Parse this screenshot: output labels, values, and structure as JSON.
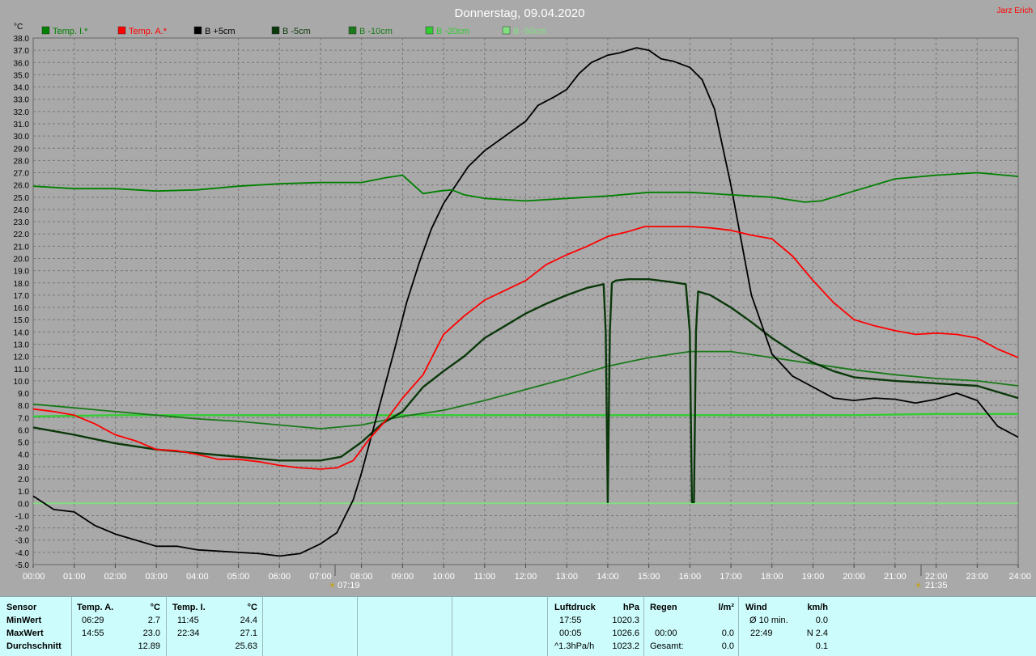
{
  "title": "Donnerstag, 09.04.2020",
  "author": "Jarz Erich",
  "unit_label": "°C",
  "sun_markers": {
    "sunrise": "07:19",
    "sunset": "21:35"
  },
  "chart_data": {
    "type": "line",
    "title": "Donnerstag, 09.04.2020",
    "ylabel": "°C",
    "ylim": [
      -5.0,
      38.0
    ],
    "xlim": [
      0,
      24
    ],
    "grid": true,
    "legend_position": "top",
    "x_ticks": [
      "00:00",
      "01:00",
      "02:00",
      "03:00",
      "04:00",
      "05:00",
      "06:00",
      "07:00",
      "08:00",
      "09:00",
      "10:00",
      "11:00",
      "12:00",
      "13:00",
      "14:00",
      "15:00",
      "16:00",
      "17:00",
      "18:00",
      "19:00",
      "20:00",
      "21:00",
      "22:00",
      "23:00",
      "24:00"
    ],
    "y_ticks": [
      38.0,
      37.0,
      36.0,
      35.0,
      34.0,
      33.0,
      32.0,
      31.0,
      30.0,
      29.0,
      28.0,
      27.0,
      26.0,
      25.0,
      24.0,
      23.0,
      22.0,
      21.0,
      20.0,
      19.0,
      18.0,
      17.0,
      16.0,
      15.0,
      14.0,
      13.0,
      12.0,
      11.0,
      10.0,
      9.0,
      8.0,
      7.0,
      6.0,
      5.0,
      4.0,
      3.0,
      2.0,
      1.0,
      0.0,
      -1.0,
      -2.0,
      -3.0,
      -4.0,
      -5.0
    ],
    "series": [
      {
        "name": "Temp. I.*",
        "color": "#008000",
        "x": [
          0,
          1,
          2,
          3,
          4,
          5,
          6,
          7,
          8,
          8.6,
          9.0,
          9.5,
          9.9,
          10.2,
          10.5,
          11,
          12,
          13,
          14,
          15,
          16,
          17,
          18,
          18.8,
          19.2,
          20,
          21,
          22,
          23,
          24
        ],
        "y": [
          25.9,
          25.7,
          25.7,
          25.5,
          25.6,
          25.9,
          26.1,
          26.2,
          26.2,
          26.6,
          26.8,
          25.3,
          25.5,
          25.6,
          25.2,
          24.9,
          24.7,
          24.9,
          25.1,
          25.4,
          25.4,
          25.2,
          25.0,
          24.6,
          24.7,
          25.5,
          26.5,
          26.8,
          27.0,
          26.7
        ]
      },
      {
        "name": "Temp. A.*",
        "color": "#ff0000",
        "x": [
          0,
          0.5,
          1,
          1.5,
          2,
          2.5,
          3,
          3.5,
          4,
          4.5,
          5,
          5.5,
          6,
          6.5,
          7,
          7.4,
          7.8,
          8.2,
          8.6,
          9.0,
          9.5,
          10,
          10.5,
          11,
          11.5,
          12,
          12.5,
          13,
          13.5,
          14,
          14.5,
          14.9,
          15.5,
          16,
          16.5,
          17,
          17.5,
          18,
          18.5,
          19,
          19.5,
          20,
          20.5,
          21,
          21.5,
          22,
          22.5,
          23,
          23.5,
          24
        ],
        "y": [
          7.7,
          7.5,
          7.2,
          6.5,
          5.6,
          5.1,
          4.4,
          4.3,
          4.0,
          3.6,
          3.6,
          3.4,
          3.1,
          2.9,
          2.8,
          2.9,
          3.5,
          5.3,
          6.8,
          8.6,
          10.5,
          13.8,
          15.3,
          16.6,
          17.4,
          18.2,
          19.5,
          20.3,
          21.0,
          21.8,
          22.2,
          22.6,
          22.6,
          22.6,
          22.5,
          22.3,
          21.9,
          21.6,
          20.2,
          18.2,
          16.4,
          15.0,
          14.5,
          14.1,
          13.8,
          13.9,
          13.8,
          13.5,
          12.6,
          11.9
        ]
      },
      {
        "name": "B +5cm",
        "color": "#000000",
        "x": [
          0,
          0.5,
          1,
          1.5,
          2,
          2.5,
          3,
          3.5,
          4,
          4.5,
          5,
          5.5,
          6,
          6.5,
          7,
          7.4,
          7.8,
          8.0,
          8.4,
          8.8,
          9.1,
          9.4,
          9.7,
          10,
          10.3,
          10.6,
          11,
          11.5,
          12,
          12.3,
          12.7,
          13,
          13.3,
          13.6,
          14,
          14.3,
          14.7,
          15.0,
          15.3,
          15.6,
          16,
          16.3,
          16.6,
          17,
          17.5,
          18,
          18.5,
          19,
          19.5,
          20,
          20.5,
          21,
          21.5,
          22,
          22.5,
          23,
          23.5,
          24
        ],
        "y": [
          0.6,
          -0.5,
          -0.7,
          -1.8,
          -2.5,
          -3.0,
          -3.5,
          -3.5,
          -3.8,
          -3.9,
          -4.0,
          -4.1,
          -4.3,
          -4.1,
          -3.3,
          -2.4,
          0.3,
          2.5,
          7.5,
          12.5,
          16.4,
          19.6,
          22.4,
          24.5,
          26.0,
          27.5,
          28.8,
          30.0,
          31.2,
          32.5,
          33.2,
          33.8,
          35.1,
          36.0,
          36.6,
          36.8,
          37.2,
          37.0,
          36.3,
          36.1,
          35.6,
          34.6,
          32.2,
          26.0,
          17.0,
          12.2,
          10.4,
          9.5,
          8.6,
          8.4,
          8.6,
          8.5,
          8.2,
          8.5,
          9.0,
          8.4,
          6.3,
          5.4
        ]
      },
      {
        "name": "B -5cm",
        "color": "#0a380a",
        "x": [
          0,
          1,
          2,
          3,
          4,
          5,
          6,
          7,
          7.5,
          8,
          8.5,
          9,
          9.5,
          10,
          10.5,
          11,
          11.5,
          12,
          12.5,
          13,
          13.5,
          13.9,
          13.95,
          14.0,
          14.05,
          14.1,
          14.2,
          14.5,
          15,
          15.5,
          15.9,
          16.0,
          16.05,
          16.1,
          16.15,
          16.2,
          16.5,
          17,
          17.5,
          18,
          18.5,
          19,
          19.5,
          20,
          21,
          22,
          23,
          24
        ],
        "y": [
          6.2,
          5.6,
          4.9,
          4.4,
          4.1,
          3.8,
          3.5,
          3.5,
          3.8,
          5.0,
          6.5,
          7.5,
          9.5,
          10.8,
          12.0,
          13.5,
          14.5,
          15.5,
          16.3,
          17.0,
          17.6,
          17.9,
          14.0,
          0.1,
          14.0,
          18.0,
          18.2,
          18.3,
          18.3,
          18.1,
          17.9,
          14.0,
          0.1,
          0.1,
          14.0,
          17.3,
          17.0,
          16.0,
          14.8,
          13.5,
          12.4,
          11.5,
          10.8,
          10.3,
          10.0,
          9.8,
          9.6,
          8.6
        ]
      },
      {
        "name": "B -10cm",
        "color": "#1a7a1a",
        "x": [
          0,
          1,
          2,
          3,
          4,
          5,
          6,
          7,
          8,
          9,
          10,
          11,
          12,
          13,
          14,
          15,
          16,
          17,
          18,
          19,
          20,
          21,
          22,
          23,
          24
        ],
        "y": [
          8.1,
          7.8,
          7.5,
          7.2,
          6.9,
          6.7,
          6.4,
          6.1,
          6.4,
          7.1,
          7.6,
          8.4,
          9.3,
          10.2,
          11.2,
          11.9,
          12.4,
          12.4,
          11.9,
          11.4,
          10.9,
          10.5,
          10.2,
          10.0,
          9.6
        ]
      },
      {
        "name": "B -20cm",
        "color": "#33cc33",
        "x": [
          0,
          2,
          4,
          6,
          8,
          10,
          12,
          14,
          16,
          18,
          20,
          22,
          24
        ],
        "y": [
          7.1,
          7.2,
          7.2,
          7.2,
          7.2,
          7.2,
          7.2,
          7.2,
          7.2,
          7.2,
          7.2,
          7.3,
          7.3
        ]
      },
      {
        "name": "B -50cm",
        "color": "#80e080",
        "x": [
          0,
          24
        ],
        "y": [
          0.0,
          0.0
        ]
      }
    ]
  },
  "panel": {
    "sensor": {
      "header": "Sensor",
      "rows": [
        "MinWert",
        "MaxWert",
        "Durchschnitt"
      ]
    },
    "temp_a": {
      "header": "Temp. A.",
      "unit": "°C",
      "rows": [
        {
          "time": "06:29",
          "value": "2.7"
        },
        {
          "time": "14:55",
          "value": "23.0"
        },
        {
          "time": "",
          "value": "12.89"
        }
      ]
    },
    "temp_i": {
      "header": "Temp. I.",
      "unit": "°C",
      "rows": [
        {
          "time": "11:45",
          "value": "24.4"
        },
        {
          "time": "22:34",
          "value": "27.1"
        },
        {
          "time": "",
          "value": "25.63"
        }
      ]
    },
    "pressure": {
      "header": "Luftdruck",
      "unit": "hPa",
      "rows": [
        {
          "time": "17:55",
          "value": "1020.3"
        },
        {
          "time": "00:05",
          "value": "1026.6"
        },
        {
          "time": "^1.3hPa/h",
          "value": "1023.2"
        }
      ]
    },
    "rain": {
      "header": "Regen",
      "unit": "l/m²",
      "rows": [
        {
          "time": "",
          "value": ""
        },
        {
          "time": "00:00",
          "value": "0.0"
        },
        {
          "time": "Gesamt:",
          "value": "0.0"
        }
      ]
    },
    "wind": {
      "header": "Wind",
      "unit": "km/h",
      "rows": [
        {
          "time": "Ø 10 min.",
          "value": "0.0"
        },
        {
          "time": "22:49",
          "value": "N 2.4"
        },
        {
          "time": "",
          "value": "0.1"
        }
      ]
    }
  }
}
